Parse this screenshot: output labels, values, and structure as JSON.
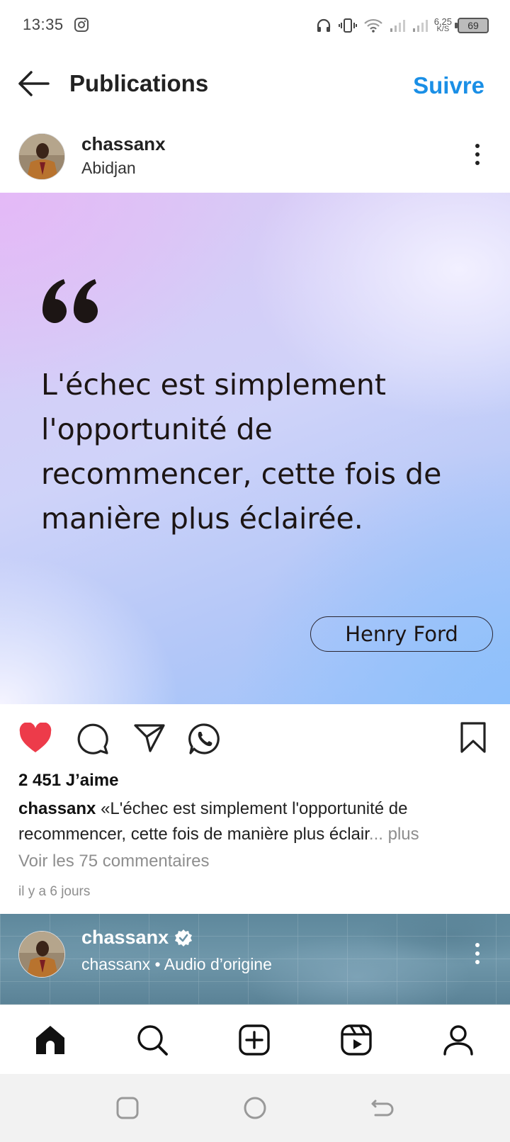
{
  "status_bar": {
    "time": "13:35",
    "speed_value": "6,25",
    "speed_unit": "K/S",
    "battery": "69",
    "icons": [
      "instagram-icon",
      "headphones-icon",
      "vibrate-icon",
      "wifi-icon",
      "signal-icon",
      "signal-icon",
      "battery-icon"
    ]
  },
  "header": {
    "title": "Publications",
    "follow_label": "Suivre",
    "back_icon": "arrow-left-icon",
    "follow_color": "#1a8fe6"
  },
  "post": {
    "username": "chassanx",
    "location": "Abidjan",
    "image": {
      "quote": "L'échec est simplement l'opportunité de recommencer, cette fois de manière plus éclairée.",
      "author": "Henry Ford"
    },
    "actions": {
      "like_icon": "heart-filled-icon",
      "comment_icon": "comment-icon",
      "share_icon": "send-icon",
      "whatsapp_icon": "whatsapp-icon",
      "save_icon": "bookmark-icon",
      "like_color": "#ed3b4a"
    },
    "likes": "2 451 J’aime",
    "caption_user": "chassanx",
    "caption_text": "«L'échec est simplement l'opportunité de recommencer, cette fois de manière plus éclair",
    "caption_ellipsis": "...",
    "caption_more": " plus",
    "comments_link": "Voir les 75 commentaires",
    "date": "il y a 6 jours"
  },
  "next_post": {
    "username": "chassanx",
    "verified_icon": "verified-badge-icon",
    "subtitle": "chassanx • Audio d’origine"
  },
  "bottom_nav": {
    "items": [
      "home-icon",
      "search-icon",
      "create-icon",
      "reels-icon",
      "profile-icon"
    ]
  },
  "system_nav": {
    "items": [
      "recents-icon",
      "home-circle-icon",
      "back-icon"
    ]
  }
}
